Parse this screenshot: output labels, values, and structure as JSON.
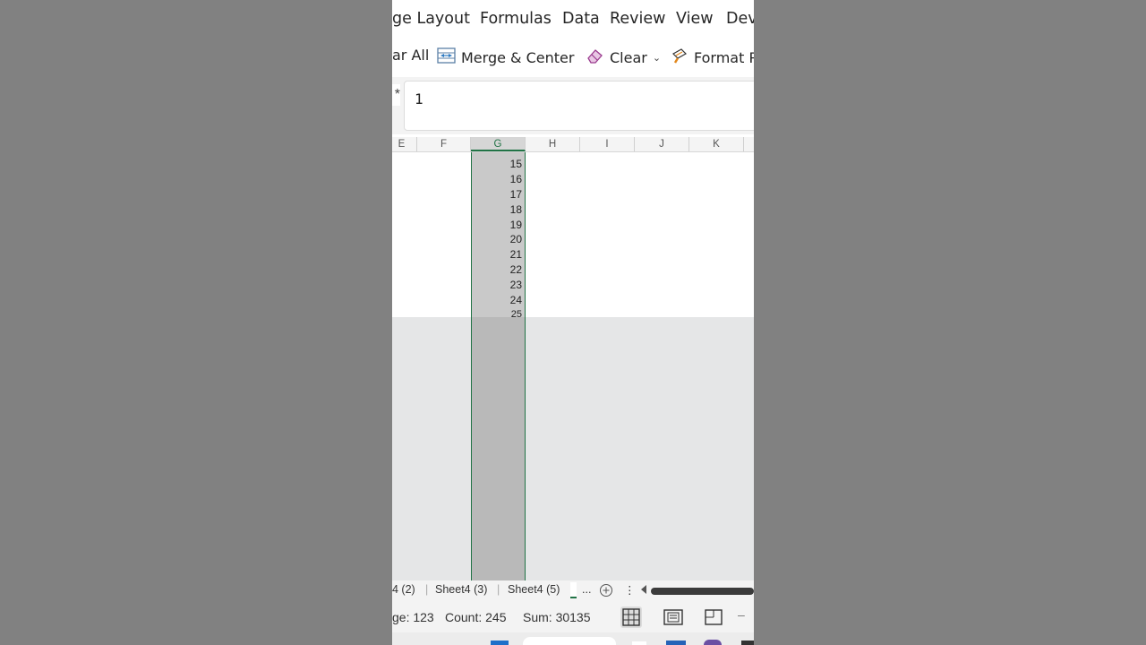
{
  "menu": {
    "tabs": [
      "ge Layout",
      "Formulas",
      "Data",
      "Review",
      "View",
      "Dev"
    ]
  },
  "ribbon": {
    "clear_all": "ar All",
    "merge_center": "Merge & Center",
    "clear": "Clear",
    "format_painter": "Format P"
  },
  "formula_bar": {
    "value": "1"
  },
  "columns": [
    "E",
    "F",
    "G",
    "H",
    "I",
    "J",
    "K"
  ],
  "selected_column": "G",
  "column_g_values": [
    "15",
    "16",
    "17",
    "18",
    "19",
    "20",
    "21",
    "22",
    "23",
    "24",
    "25"
  ],
  "sheet_tabs": [
    "4 (2)",
    "Sheet4 (3)",
    "Sheet4 (5)"
  ],
  "sheet_tab_more": "...",
  "status": {
    "average": "ge: 123",
    "count": "Count: 245",
    "sum": "Sum: 30135"
  },
  "colors": {
    "accent_green": "#217346",
    "background": "#818181",
    "selection": "#b9b9b9"
  }
}
